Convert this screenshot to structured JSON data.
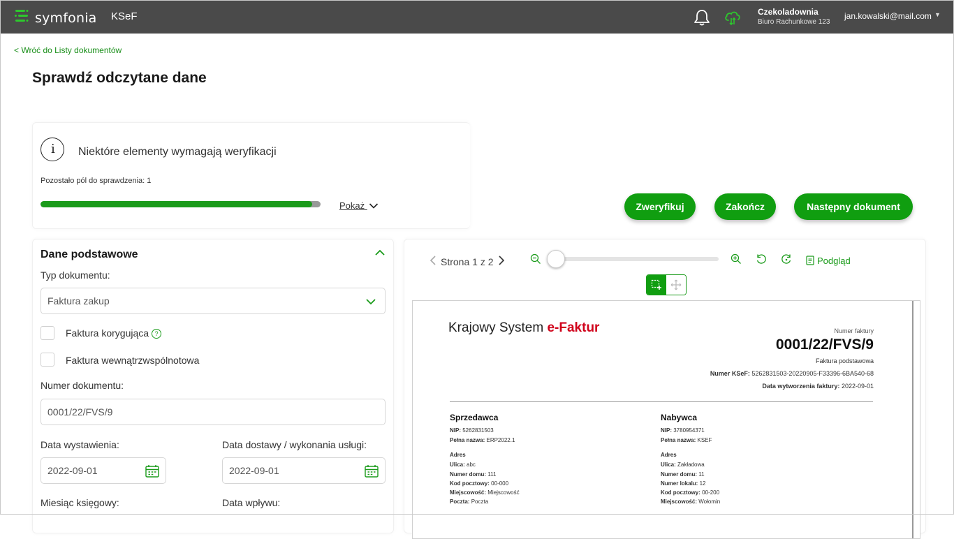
{
  "topbar": {
    "brand": "symfonia",
    "product": "KSeF",
    "org_name": "Czekoladownia",
    "org_sub": "Biuro Rachunkowe 123",
    "user_email": "jan.kowalski@mail.com",
    "bell_icon": "bell-icon",
    "cloud_icon": "cloud-sync-icon"
  },
  "nav": {
    "back_link": "< Wróć do Listy dokumentów"
  },
  "page": {
    "title": "Sprawdź odczytane dane"
  },
  "verification": {
    "message": "Niektóre elementy wymagają weryfikacji",
    "remaining": "Pozostało pól do sprawdzenia: 1",
    "progress_percent": 97,
    "show_label": "Pokaż"
  },
  "actions": {
    "verify": "Zweryfikuj",
    "finish": "Zakończ",
    "next": "Następny dokument"
  },
  "form": {
    "section_title": "Dane podstawowe",
    "doc_type_label": "Typ dokumentu:",
    "doc_type_value": "Faktura zakup",
    "corrective_label": "Faktura korygująca",
    "intra_label": "Faktura wewnątrzwspólnotowa",
    "doc_number_label": "Numer dokumentu:",
    "doc_number_value": "0001/22/FVS/9",
    "issue_date_label": "Data wystawienia:",
    "issue_date_value": "2022-09-01",
    "delivery_date_label": "Data dostawy / wykonania usługi:",
    "delivery_date_value": "2022-09-01",
    "accounting_month_label": "Miesiąc księgowy:",
    "receipt_date_label": "Data wpływu:"
  },
  "viewer": {
    "page_label": "Strona 1 z 2",
    "zoom_level": 0,
    "preview_label": "Podgląd"
  },
  "invoice": {
    "logo_prefix": "Krajowy System ",
    "logo_highlight": "e-Faktur",
    "number_label": "Numer faktury",
    "number": "0001/22/FVS/9",
    "type": "Faktura podstawowa",
    "ksef_label": "Numer KSeF:",
    "ksef_number": "5262831503-20220905-F33396-6BA540-68",
    "created_label": "Data wytworzenia faktury:",
    "created_date": "2022-09-01",
    "seller": {
      "title": "Sprzedawca",
      "nip_label": "NIP:",
      "nip": "5262831503",
      "name_label": "Pełna nazwa:",
      "name": "ERP2022.1",
      "address_label": "Adres",
      "street_label": "Ulica:",
      "street": "abc",
      "house_label": "Numer domu:",
      "house": "111",
      "postal_label": "Kod pocztowy:",
      "postal": "00-000",
      "city_label": "Miejscowość:",
      "city": "Miejscowość",
      "post_label": "Poczta:",
      "post": "Poczta"
    },
    "buyer": {
      "title": "Nabywca",
      "nip_label": "NIP:",
      "nip": "3780954371",
      "name_label": "Pełna nazwa:",
      "name": "KSEF",
      "address_label": "Adres",
      "street_label": "Ulica:",
      "street": "Zakładowa",
      "house_label": "Numer domu:",
      "house": "11",
      "flat_label": "Numer lokalu:",
      "flat": "12",
      "postal_label": "Kod pocztowy:",
      "postal": "00-200",
      "city_label": "Miejscowość:",
      "city": "Wołomin"
    }
  }
}
